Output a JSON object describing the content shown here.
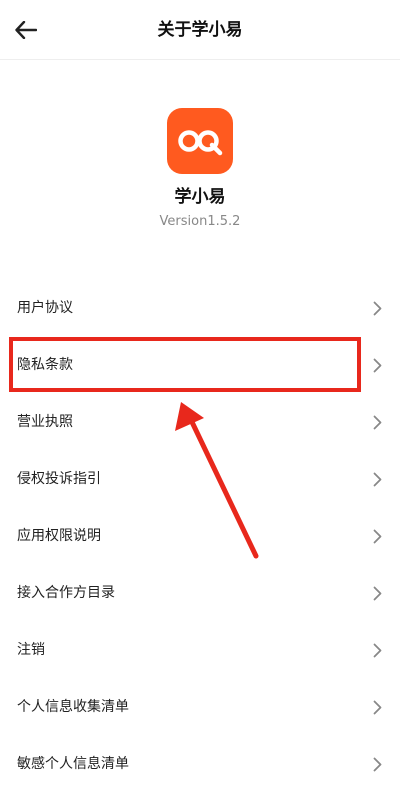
{
  "header": {
    "title": "关于学小易",
    "back_icon": "arrow-left-icon"
  },
  "app": {
    "name": "学小易",
    "version": "Version1.5.2",
    "logo_color": "#ff5a1f",
    "logo_icon": "infinity-q-logo-icon"
  },
  "menu": {
    "items": [
      {
        "label": "用户协议"
      },
      {
        "label": "隐私条款"
      },
      {
        "label": "营业执照"
      },
      {
        "label": "侵权投诉指引"
      },
      {
        "label": "应用权限说明"
      },
      {
        "label": "接入合作方目录"
      },
      {
        "label": "注销"
      },
      {
        "label": "个人信息收集清单"
      },
      {
        "label": "敏感个人信息清单"
      }
    ],
    "chevron_icon": "chevron-right-icon"
  },
  "annotation": {
    "color": "#e8281c"
  }
}
